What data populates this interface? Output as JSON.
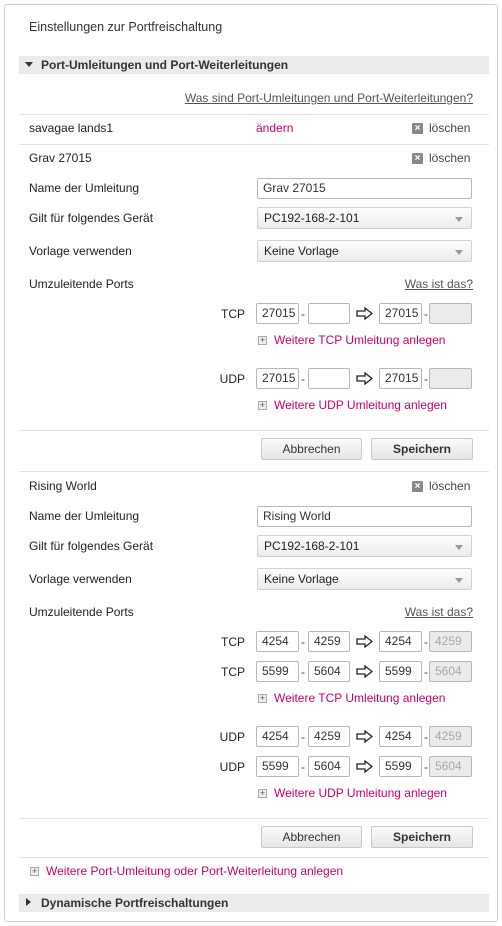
{
  "panel_title": "Einstellungen zur Portfreischaltung",
  "section1": {
    "label": "Port-Umleitungen und Port-Weiterleitungen"
  },
  "help_link": "Was sind Port-Umleitungen und Port-Weiterleitungen?",
  "entry_savagae": {
    "name": "savagae lands1",
    "edit": "ändern",
    "delete": "löschen"
  },
  "labels": {
    "name": "Name der Umleitung",
    "device": "Gilt für folgendes Gerät",
    "template": "Vorlage verwenden",
    "ports": "Umzuleitende Ports",
    "what": "Was ist das?",
    "tcp": "TCP",
    "udp": "UDP",
    "more_tcp": "Weitere TCP Umleitung anlegen",
    "more_udp": "Weitere UDP Umleitung anlegen",
    "cancel": "Abbrechen",
    "save": "Speichern",
    "delete": "löschen",
    "dash": "-",
    "x": "×",
    "plus": "+"
  },
  "grav": {
    "header": "Grav 27015",
    "name_value": "Grav 27015",
    "device": "PC192-168-2-101",
    "template": "Keine Vorlage",
    "tcp": [
      {
        "from": "27015",
        "to": "",
        "dst_from": "27015",
        "dst_to": ""
      }
    ],
    "udp": [
      {
        "from": "27015",
        "to": "",
        "dst_from": "27015",
        "dst_to": ""
      }
    ]
  },
  "rising": {
    "header": "Rising World",
    "name_value": "Rising World",
    "device": "PC192-168-2-101",
    "template": "Keine Vorlage",
    "tcp": [
      {
        "from": "4254",
        "to": "4259",
        "dst_from": "4254",
        "dst_to": "4259"
      },
      {
        "from": "5599",
        "to": "5604",
        "dst_from": "5599",
        "dst_to": "5604"
      }
    ],
    "udp": [
      {
        "from": "4254",
        "to": "4259",
        "dst_from": "4254",
        "dst_to": "4259"
      },
      {
        "from": "5599",
        "to": "5604",
        "dst_from": "5599",
        "dst_to": "5604"
      }
    ]
  },
  "more_forward": "Weitere Port-Umleitung oder Port-Weiterleitung anlegen",
  "section2": {
    "label": "Dynamische Portfreischaltungen"
  },
  "colors": {
    "accent": "#c8006e",
    "section_bg": "#ebebeb"
  },
  "icons": {
    "delete": "x-box-icon",
    "arrow": "right-arrow-icon",
    "plus": "plus-box-icon",
    "expand": "triangle-icon"
  }
}
